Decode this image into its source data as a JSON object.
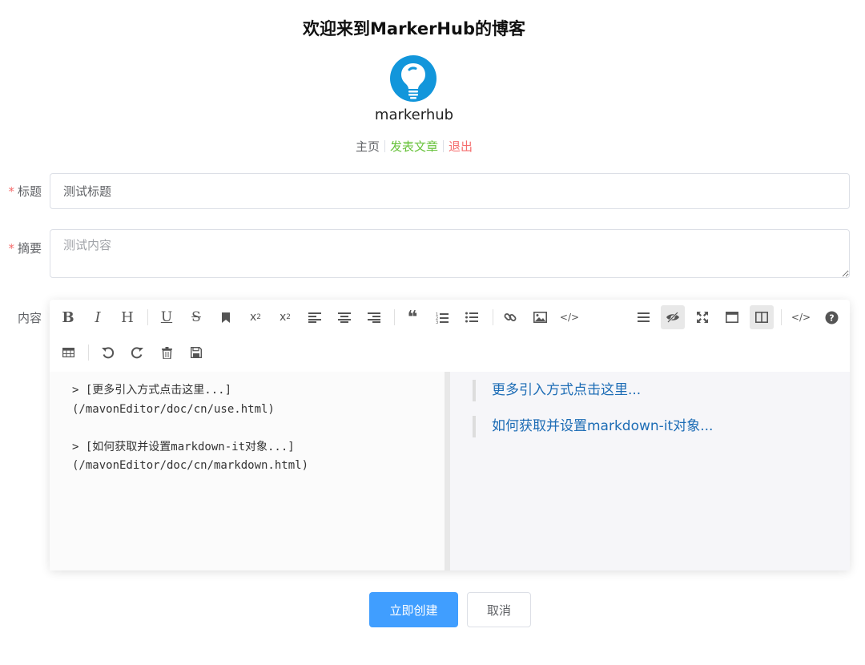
{
  "header": {
    "site_title": "欢迎来到MarkerHub的博客",
    "username": "markerhub",
    "nav": {
      "home": "主页",
      "publish": "发表文章",
      "logout": "退出"
    }
  },
  "form": {
    "title_label": "标题",
    "title_value": "测试标题",
    "summary_label": "摘要",
    "summary_placeholder": "测试内容",
    "content_label": "内容",
    "required_mark": "*"
  },
  "editor": {
    "toolbar_row1_left": [
      {
        "name": "bold-icon",
        "glyph": "B"
      },
      {
        "name": "italic-icon",
        "glyph": "I"
      },
      {
        "name": "header-icon",
        "glyph": "H"
      },
      {
        "name": "underline-icon",
        "glyph": "U"
      },
      {
        "name": "strikethrough-icon",
        "glyph": "S"
      },
      {
        "name": "mark-icon",
        "glyph": "bookmark"
      },
      {
        "name": "superscript-icon",
        "glyph": "x²"
      },
      {
        "name": "subscript-icon",
        "glyph": "x₂"
      },
      {
        "name": "align-left-icon",
        "glyph": "align-left"
      },
      {
        "name": "align-center-icon",
        "glyph": "align-center"
      },
      {
        "name": "align-right-icon",
        "glyph": "align-right"
      },
      {
        "name": "quote-icon",
        "glyph": "❝"
      },
      {
        "name": "ordered-list-icon",
        "glyph": "ol"
      },
      {
        "name": "unordered-list-icon",
        "glyph": "ul"
      },
      {
        "name": "link-icon",
        "glyph": "link"
      },
      {
        "name": "image-icon",
        "glyph": "image"
      },
      {
        "name": "code-icon",
        "glyph": "</>"
      }
    ],
    "toolbar_row1_right": [
      {
        "name": "navigation-icon",
        "glyph": "menu"
      },
      {
        "name": "preview-toggle-icon",
        "glyph": "eye-slash"
      },
      {
        "name": "fullscreen-icon",
        "glyph": "expand"
      },
      {
        "name": "read-mode-icon",
        "glyph": "window"
      },
      {
        "name": "subfield-icon",
        "glyph": "columns"
      },
      {
        "name": "html-code-icon",
        "glyph": "</>"
      },
      {
        "name": "help-icon",
        "glyph": "?"
      }
    ],
    "toolbar_row2": [
      {
        "name": "table-icon",
        "glyph": "table"
      },
      {
        "name": "undo-icon",
        "glyph": "undo"
      },
      {
        "name": "redo-icon",
        "glyph": "redo"
      },
      {
        "name": "trash-icon",
        "glyph": "trash"
      },
      {
        "name": "save-icon",
        "glyph": "save"
      }
    ],
    "source_text": "> [更多引入方式点击这里...]\n(/mavonEditor/doc/cn/use.html)\n\n> [如何获取并设置markdown-it对象...]\n(/mavonEditor/doc/cn/markdown.html)",
    "preview": [
      {
        "text": "更多引入方式点击这里..."
      },
      {
        "text": "如何获取并设置markdown-it对象..."
      }
    ]
  },
  "actions": {
    "create_label": "立即创建",
    "cancel_label": "取消"
  },
  "colors": {
    "primary": "#409eff",
    "success": "#67c23a",
    "danger": "#f56c6c",
    "link": "#1c6cb5",
    "avatar_bg": "#1296db"
  }
}
